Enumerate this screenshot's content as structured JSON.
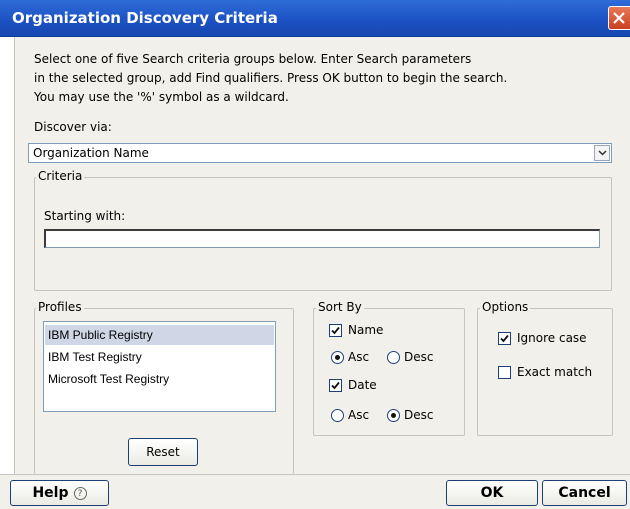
{
  "window": {
    "title": "Organization Discovery Criteria"
  },
  "instructions": [
    "Select one of five Search criteria groups below. Enter Search parameters",
    "in the selected group, add Find qualifiers. Press OK button to begin the search.",
    "You may use the '%' symbol as a wildcard."
  ],
  "discover": {
    "label": "Discover via:",
    "selected": "Organization Name"
  },
  "criteria": {
    "legend": "Criteria",
    "starting_label": "Starting with:",
    "starting_value": ""
  },
  "profiles": {
    "legend": "Profiles",
    "items": [
      "IBM Public Registry",
      "IBM Test Registry",
      "Microsoft Test Registry"
    ],
    "selected_index": 0,
    "reset_label": "Reset"
  },
  "sort": {
    "legend": "Sort By",
    "name_label": "Name",
    "name_checked": true,
    "name_asc": "Asc",
    "name_desc": "Desc",
    "name_order": "Asc",
    "date_label": "Date",
    "date_checked": true,
    "date_asc": "Asc",
    "date_desc": "Desc",
    "date_order": "Desc"
  },
  "options": {
    "legend": "Options",
    "ignore_case": "Ignore case",
    "ignore_case_checked": true,
    "exact_match": "Exact match",
    "exact_match_checked": false
  },
  "footer": {
    "help": "Help",
    "help_icon": "?",
    "ok": "OK",
    "cancel": "Cancel"
  }
}
